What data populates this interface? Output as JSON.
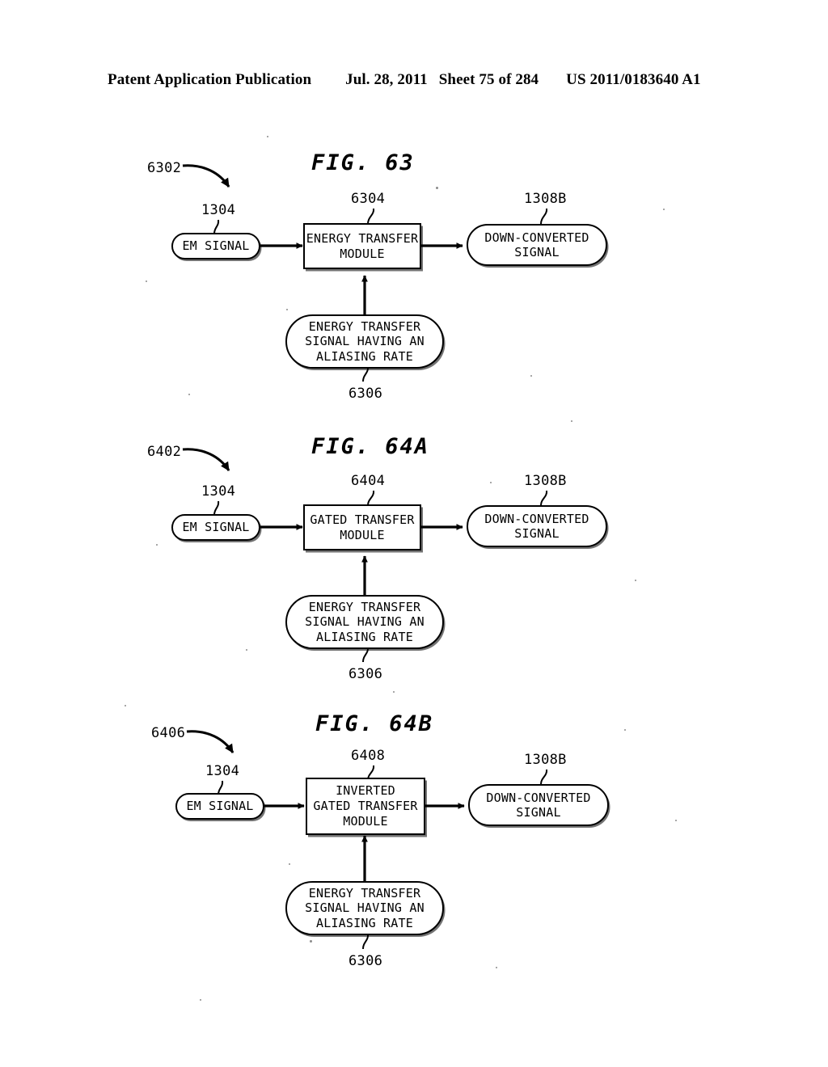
{
  "header": {
    "publication": "Patent Application Publication",
    "date": "Jul. 28, 2011",
    "sheet": "Sheet 75 of 284",
    "docnum": "US 2011/0183640 A1"
  },
  "common": {
    "em_signal_label": "EM SIGNAL",
    "down_converted_line1": "DOWN-CONVERTED",
    "down_converted_line2": "SIGNAL",
    "transfer_signal_line1": "ENERGY TRANSFER",
    "transfer_signal_line2": "SIGNAL HAVING AN",
    "transfer_signal_line3": "ALIASING RATE",
    "ref_em_signal": "1304",
    "ref_down_converted": "1308B",
    "ref_transfer_signal": "6306"
  },
  "figures": [
    {
      "id": "fig63",
      "title": "FIG. 63",
      "system_ref": "6302",
      "module_ref": "6304",
      "module_lines": [
        "ENERGY TRANSFER",
        "MODULE"
      ],
      "input_ref": "1304",
      "output_ref": "1308B",
      "control_ref": "6306",
      "input_label": "EM SIGNAL",
      "output_lines": [
        "DOWN-CONVERTED",
        "SIGNAL"
      ],
      "control_lines": [
        "ENERGY TRANSFER",
        "SIGNAL HAVING AN",
        "ALIASING RATE"
      ]
    },
    {
      "id": "fig64a",
      "title": "FIG. 64A",
      "system_ref": "6402",
      "module_ref": "6404",
      "module_lines": [
        "GATED TRANSFER",
        "MODULE"
      ],
      "input_ref": "1304",
      "output_ref": "1308B",
      "control_ref": "6306",
      "input_label": "EM SIGNAL",
      "output_lines": [
        "DOWN-CONVERTED",
        "SIGNAL"
      ],
      "control_lines": [
        "ENERGY TRANSFER",
        "SIGNAL HAVING AN",
        "ALIASING RATE"
      ]
    },
    {
      "id": "fig64b",
      "title": "FIG. 64B",
      "system_ref": "6406",
      "module_ref": "6408",
      "module_lines": [
        "INVERTED",
        "GATED TRANSFER",
        "MODULE"
      ],
      "input_ref": "1304",
      "output_ref": "1308B",
      "control_ref": "6306",
      "input_label": "EM SIGNAL",
      "output_lines": [
        "DOWN-CONVERTED",
        "SIGNAL"
      ],
      "control_lines": [
        "ENERGY TRANSFER",
        "SIGNAL HAVING AN",
        "ALIASING RATE"
      ]
    }
  ]
}
